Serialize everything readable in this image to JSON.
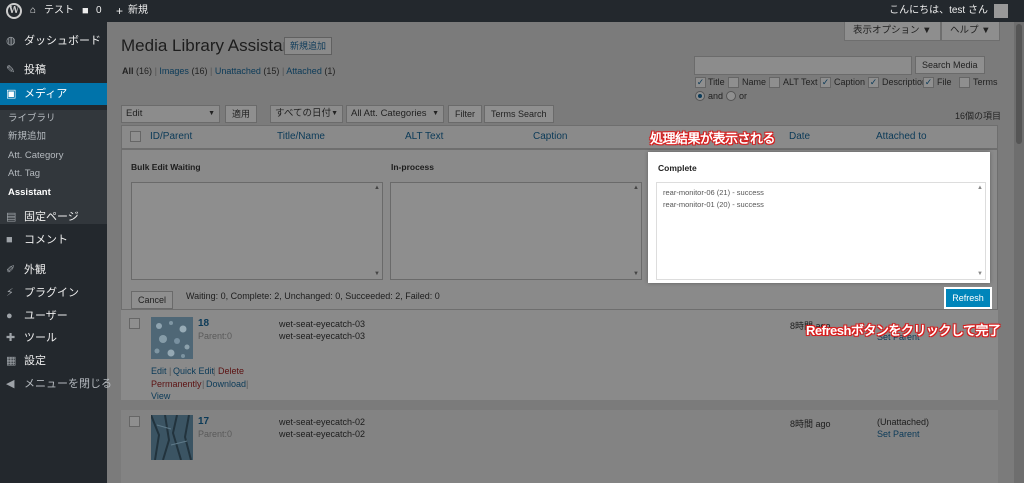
{
  "admin_bar": {
    "site_name": "テスト",
    "comment_count": "0",
    "new_label": "新規",
    "greeting": "こんにちは、test さん"
  },
  "sidebar": {
    "items": [
      {
        "label": "ダッシュボード",
        "icon": "dashboard-icon"
      },
      {
        "label": "投稿",
        "icon": "pin-icon"
      },
      {
        "label": "メディア",
        "icon": "media-icon"
      },
      {
        "label": "固定ページ",
        "icon": "pages-icon"
      },
      {
        "label": "コメント",
        "icon": "comment-icon"
      },
      {
        "label": "外観",
        "icon": "appearance-icon"
      },
      {
        "label": "プラグイン",
        "icon": "plugin-icon"
      },
      {
        "label": "ユーザー",
        "icon": "user-icon"
      },
      {
        "label": "ツール",
        "icon": "tool-icon"
      },
      {
        "label": "設定",
        "icon": "settings-icon"
      },
      {
        "label": "メニューを閉じる",
        "icon": "collapse-icon"
      }
    ],
    "submenu": [
      "ライブラリ",
      "新規追加",
      "Att. Category",
      "Att. Tag",
      "Assistant"
    ]
  },
  "header": {
    "title": "Media Library Assistant",
    "add_new": "新規追加",
    "screen_options": "表示オプション ▼",
    "help": "ヘルプ ▼"
  },
  "views": {
    "all": "All",
    "all_count": "(16)",
    "images": "Images",
    "images_count": "(16)",
    "unattached": "Unattached",
    "unattached_count": "(15)",
    "attached": "Attached",
    "attached_count": "(1)"
  },
  "search": {
    "value": "",
    "button": "Search Media",
    "fields": [
      {
        "label": "Title",
        "checked": true
      },
      {
        "label": "Name",
        "checked": false
      },
      {
        "label": "ALT Text",
        "checked": false
      },
      {
        "label": "Caption",
        "checked": true
      },
      {
        "label": "Description",
        "checked": true
      },
      {
        "label": "File",
        "checked": true
      },
      {
        "label": "Terms",
        "checked": false
      }
    ],
    "connector_and": "and",
    "connector_or": "or"
  },
  "filters": {
    "bulk_action": "Edit",
    "apply": "適用",
    "dates": "すべての日付",
    "categories": "All Att. Categories",
    "filter": "Filter",
    "terms_search": "Terms Search",
    "count": "16個の項目"
  },
  "table": {
    "columns": [
      "ID/Parent",
      "Title/Name",
      "ALT Text",
      "Caption",
      "Date",
      "Attached to"
    ]
  },
  "bulk_edit": {
    "waiting_label": "Bulk Edit Waiting",
    "inprocess_label": "In-process",
    "complete_label": "Complete",
    "complete_lines": [
      "rear-monitor-06 (21) - success",
      "rear-monitor-01 (20) - success"
    ],
    "cancel": "Cancel",
    "summary": "Waiting: 0, Complete: 2, Unchanged: 0, Succeeded: 2, Failed: 0",
    "refresh": "Refresh"
  },
  "rows": [
    {
      "id": "18",
      "parent": "Parent:0",
      "title": "wet-seat-eyecatch-03",
      "name": "wet-seat-eyecatch-03",
      "date": "8時間 ago",
      "attached": "Set Parent",
      "actions": {
        "edit": "Edit",
        "quick_edit": "Quick Edit",
        "delete": "Delete",
        "permanently": "Permanently",
        "download": "Download",
        "view": "View"
      }
    },
    {
      "id": "17",
      "parent": "Parent:0",
      "title": "wet-seat-eyecatch-02",
      "name": "wet-seat-eyecatch-02",
      "date": "8時間 ago",
      "attached_status": "(Unattached)",
      "attached": "Set Parent"
    }
  ],
  "annotations": {
    "result_shown": "処理結果が表示される",
    "click_refresh": "Refreshボタンをクリックして完了"
  },
  "colors": {
    "accent": "#0073aa",
    "refresh_button": "#0085ba",
    "annotation_outline": "#d81c1c",
    "adminbar": "#23282d"
  }
}
